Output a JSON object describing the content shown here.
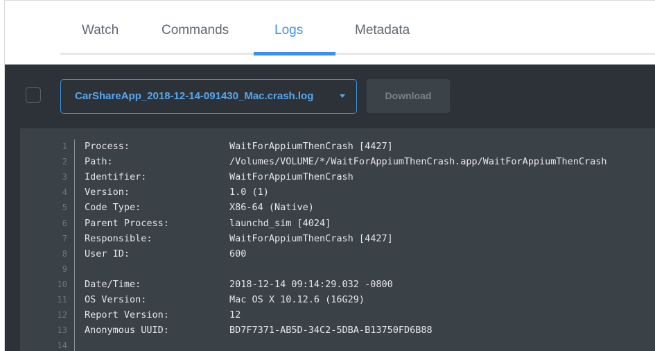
{
  "tabs": [
    {
      "label": "Watch"
    },
    {
      "label": "Commands"
    },
    {
      "label": "Logs",
      "active": true
    },
    {
      "label": "Metadata"
    }
  ],
  "colors": {
    "accent": "#3d93e0",
    "panel_bg": "#2c3237",
    "log_bg": "#3a4147"
  },
  "toolbar": {
    "selected_log": "CarShareApp_2018-12-14-091430_Mac.crash.log",
    "download_label": "Download"
  },
  "log": {
    "lines": [
      {
        "n": "1",
        "key": "Process:",
        "value": "WaitForAppiumThenCrash [4427]"
      },
      {
        "n": "2",
        "key": "Path:",
        "value": "/Volumes/VOLUME/*/WaitForAppiumThenCrash.app/WaitForAppiumThenCrash"
      },
      {
        "n": "3",
        "key": "Identifier:",
        "value": "WaitForAppiumThenCrash"
      },
      {
        "n": "4",
        "key": "Version:",
        "value": "1.0 (1)"
      },
      {
        "n": "5",
        "key": "Code Type:",
        "value": "X86-64 (Native)"
      },
      {
        "n": "6",
        "key": "Parent Process:",
        "value": "launchd_sim [4024]"
      },
      {
        "n": "7",
        "key": "Responsible:",
        "value": "WaitForAppiumThenCrash [4427]"
      },
      {
        "n": "8",
        "key": "User ID:",
        "value": "600"
      },
      {
        "n": "9",
        "key": "",
        "value": ""
      },
      {
        "n": "10",
        "key": "Date/Time:",
        "value": "2018-12-14 09:14:29.032 -0800"
      },
      {
        "n": "11",
        "key": "OS Version:",
        "value": "Mac OS X 10.12.6 (16G29)"
      },
      {
        "n": "12",
        "key": "Report Version:",
        "value": "12"
      },
      {
        "n": "13",
        "key": "Anonymous UUID:",
        "value": "BD7F7371-AB5D-34C2-5DBA-B13750FD6B88"
      },
      {
        "n": "14",
        "key": "",
        "value": ""
      }
    ]
  }
}
